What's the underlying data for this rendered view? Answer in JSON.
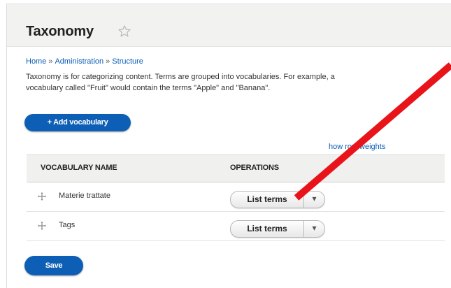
{
  "page": {
    "title": "Taxonomy",
    "favorite_icon": "star-outline-icon"
  },
  "breadcrumb": [
    {
      "label": "Home"
    },
    {
      "label": "Administration"
    },
    {
      "label": "Structure"
    }
  ],
  "breadcrumb_separator": "»",
  "description": {
    "line1": "Taxonomy is for categorizing content. Terms are grouped into vocabularies. For example, a",
    "line2": "vocabulary called \"Fruit\" would contain the terms \"Apple\" and \"Banana\"."
  },
  "actions": {
    "add_vocabulary_label": "+ Add vocabulary",
    "show_row_weights_label": "how row weights",
    "save_label": "Save"
  },
  "table": {
    "columns": [
      "VOCABULARY NAME",
      "OPERATIONS"
    ],
    "rows": [
      {
        "name": "Materie trattate",
        "operation_label": "List terms",
        "dropdown_icon": "chevron-down-icon",
        "drag_icon": "drag-handle-icon"
      },
      {
        "name": "Tags",
        "operation_label": "List terms",
        "dropdown_icon": "chevron-down-icon",
        "drag_icon": "drag-handle-icon"
      }
    ]
  },
  "colors": {
    "primary_button": "#0d5fb5",
    "link": "#0a5db8",
    "annotation_arrow": "#e8141a",
    "header_background": "#f2f2f0"
  }
}
